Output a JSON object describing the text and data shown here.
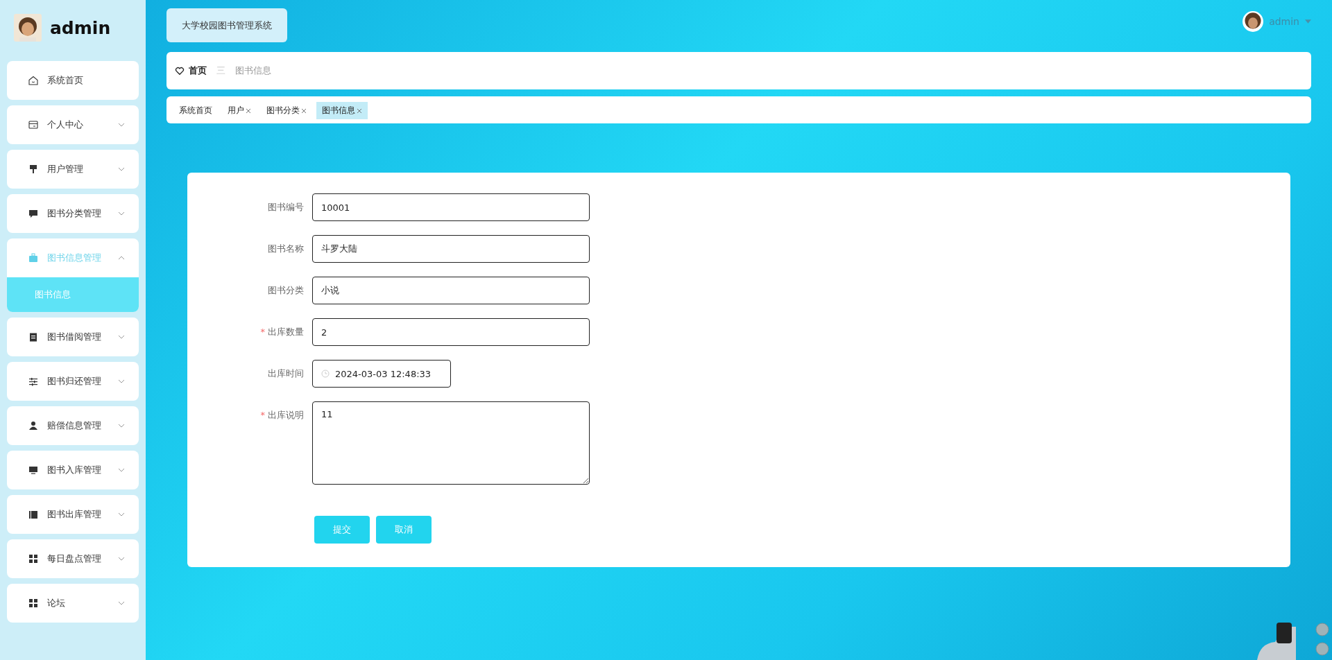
{
  "sidebar": {
    "user": "admin",
    "items": [
      {
        "label": "系统首页",
        "kind": "link",
        "selected": false
      },
      {
        "label": "个人中心",
        "kind": "group",
        "expanded": false,
        "selected": false
      },
      {
        "label": "用户管理",
        "kind": "group",
        "expanded": false,
        "selected": false
      },
      {
        "label": "图书分类管理",
        "kind": "group",
        "expanded": false,
        "selected": false
      },
      {
        "label": "图书信息管理",
        "kind": "group",
        "expanded": true,
        "selected": true,
        "children": [
          {
            "label": "图书信息",
            "selected": true
          }
        ]
      },
      {
        "label": "图书借阅管理",
        "kind": "group",
        "expanded": false,
        "selected": false
      },
      {
        "label": "图书归还管理",
        "kind": "group",
        "expanded": false,
        "selected": false
      },
      {
        "label": "赔偿信息管理",
        "kind": "group",
        "expanded": false,
        "selected": false
      },
      {
        "label": "图书入库管理",
        "kind": "group",
        "expanded": false,
        "selected": false
      },
      {
        "label": "图书出库管理",
        "kind": "group",
        "expanded": false,
        "selected": false
      },
      {
        "label": "每日盘点管理",
        "kind": "group",
        "expanded": false,
        "selected": false
      },
      {
        "label": "论坛",
        "kind": "group",
        "expanded": false,
        "selected": false
      }
    ]
  },
  "header": {
    "title": "大学校园图书管理系统",
    "user": "admin"
  },
  "breadcrumb": {
    "home": "首页",
    "separator": "三",
    "current": "图书信息"
  },
  "tabs": [
    {
      "label": "系统首页",
      "kind": "fixed",
      "selected": false
    },
    {
      "label": "用户",
      "kind": "closable",
      "selected": false
    },
    {
      "label": "图书分类",
      "kind": "closable",
      "selected": false
    },
    {
      "label": "图书信息",
      "kind": "closable",
      "selected": true
    }
  ],
  "form": {
    "fields": [
      {
        "label": "图书编号",
        "value": "10001",
        "kind": "text"
      },
      {
        "label": "图书名称",
        "value": "斗罗大陆",
        "kind": "text"
      },
      {
        "label": "图书分类",
        "value": "小说",
        "kind": "text"
      },
      {
        "label": "出库数量",
        "value": "2",
        "kind": "text",
        "mark": "*"
      },
      {
        "label": "出库时间",
        "value": "2024-03-03 12:48:33",
        "kind": "datetime"
      },
      {
        "label": "出库说明",
        "value": "11",
        "kind": "textarea",
        "mark": "*"
      }
    ],
    "buttons": [
      "提交",
      "取消"
    ]
  }
}
